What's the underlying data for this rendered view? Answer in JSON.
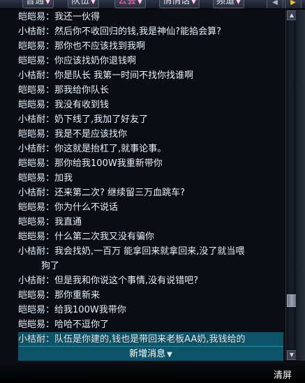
{
  "tabs": [
    {
      "label": "普通",
      "pink": false
    },
    {
      "label": "队伍",
      "pink": false
    },
    {
      "label": "公会",
      "pink": true
    },
    {
      "label": "悄悄话",
      "pink": false
    },
    {
      "label": "频道",
      "pink": false
    }
  ],
  "messages": [
    {
      "sender": "皑皑易",
      "text": "我还一伙得"
    },
    {
      "sender": "小桔耐",
      "text": "然后你不收回归的钱,我是神仙?能掐会算?"
    },
    {
      "sender": "皑皑易",
      "text": "那你也不应该找到我啊"
    },
    {
      "sender": "皑皑易",
      "text": "你应该找奶你退钱啊"
    },
    {
      "sender": "小桔耐",
      "text": "你是队长 我第一时间不找你找谁啊"
    },
    {
      "sender": "皑皑易",
      "text": "那我给你队长"
    },
    {
      "sender": "皑皑易",
      "text": "我没有收到钱"
    },
    {
      "sender": "小桔耐",
      "text": "奶下线了,我加了好友了"
    },
    {
      "sender": "皑皑易",
      "text": "我是不是应该找你"
    },
    {
      "sender": "小桔耐",
      "text": "你这就是抬杠了,就事论事。"
    },
    {
      "sender": "皑皑易",
      "text": "那你给我100W我重新带你"
    },
    {
      "sender": "皑皑易",
      "text": "加我"
    },
    {
      "sender": "小桔耐",
      "text": "还来第二次? 继续留三万血跳车?"
    },
    {
      "sender": "皑皑易",
      "text": "你为什么不说话"
    },
    {
      "sender": "皑皑易",
      "text": "我直通"
    },
    {
      "sender": "皑皑易",
      "text": "什么第二次我又没有骗你"
    },
    {
      "sender": "小桔耐",
      "text": "我会找奶,一百万 能拿回来就拿回来,没了就当喂",
      "cont": "狗了"
    },
    {
      "sender": "小桔耐",
      "text": "但是我和你说这个事情,没有说错吧?"
    },
    {
      "sender": "皑皑易",
      "text": "那你重新来"
    },
    {
      "sender": "皑皑易",
      "text": "给我100W我带你"
    },
    {
      "sender": "皑皑易",
      "text": "哈哈不逗你了"
    },
    {
      "sender": "小桔耐",
      "text": "队伍是你建的,钱也是带回来老板AA奶,我钱给的"
    }
  ],
  "new_message_label": "新增消息",
  "clear_label": "清屏"
}
